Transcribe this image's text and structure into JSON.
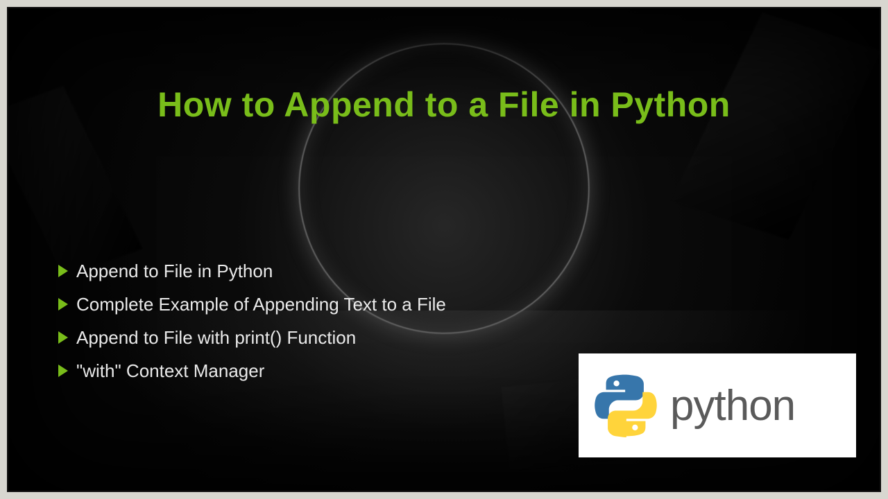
{
  "title": "How to Append to a File in Python",
  "bullets": [
    "Append to File in Python",
    "Complete Example of Appending Text to a File",
    "Append to File with print() Function",
    "\"with\" Context Manager"
  ],
  "logo": {
    "text": "python",
    "name": "python-logo"
  },
  "colors": {
    "accent": "#79bd1a",
    "text": "#eaeaea",
    "logo_blue": "#3776AB",
    "logo_yellow": "#FFD43B"
  }
}
